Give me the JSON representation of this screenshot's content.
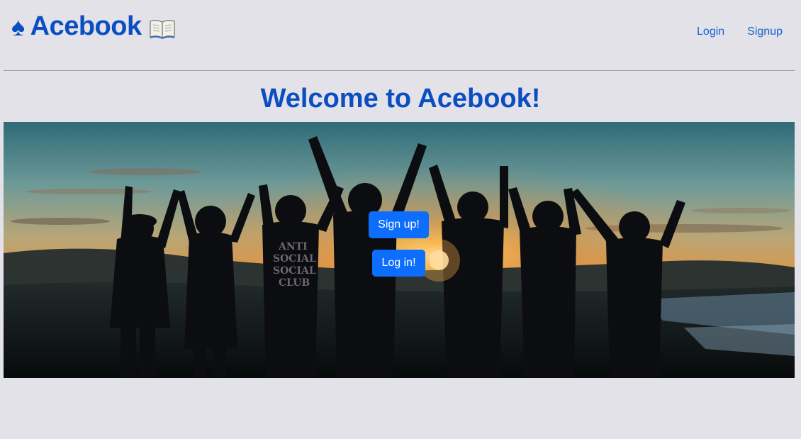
{
  "brand": {
    "name": "Acebook",
    "spade_symbol": "♠",
    "color": "#0a4ec2"
  },
  "nav": {
    "login_label": "Login",
    "signup_label": "Signup",
    "link_color": "#1563d1"
  },
  "main": {
    "title": "Welcome to Acebook!",
    "signup_button_label": "Sign up!",
    "login_button_label": "Log in!",
    "button_color": "#0d6efd"
  },
  "hero": {
    "icon": "sunset-crowd-photo"
  }
}
